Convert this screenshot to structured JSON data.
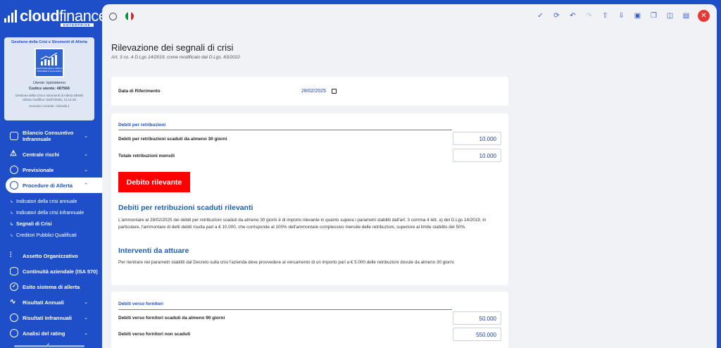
{
  "brand": {
    "name_bold": "cloud",
    "name_light": "finance",
    "tagline": "ENTERPRISE"
  },
  "card": {
    "title": "Gestione della Crisi e Strumenti di Allerta",
    "image_label": "GESTIONE DELLA CRISI E STRUMENTI DI ALLERTA",
    "user": "Utente: bpilotdemo",
    "code": "Codice utente: 487566",
    "product": "Gestione della Crisi e Strumenti di Allerta DEMO",
    "last_mod": "Ultima modifica: 04/07/2025, 12:14:40",
    "scenario": "Scenario corrente: Azienda 1"
  },
  "nav": {
    "bilancio": "Bilancio Consuntivo Infrannuale",
    "centrale": "Centrale rischi",
    "previsionale": "Previsionale",
    "procedure": "Procedure di Allerta",
    "sub": {
      "annuale": "Indicatori della crisi annuale",
      "infrannuale": "Indicatori della crisi infrannuale",
      "segnali": "Segnali di Crisi",
      "creditori": "Creditori Pubblici Qualificati"
    },
    "assetto": "Assetto Organizzativo",
    "continuita": "Continuità aziendale (ISA 570)",
    "esito": "Esito sistema di allerta",
    "annuali": "Risultati Annuali",
    "infrannuali": "Risultati Infrannuali",
    "rating": "Analisi del rating"
  },
  "page": {
    "title": "Rilevazione dei segnali di crisi",
    "subtitle": "Art. 3 co. 4 D.Lgs 14/2019, come modificato dal D.Lgs. 83/2022"
  },
  "date": {
    "label": "Data di Riferimento",
    "value": "28/02/2025"
  },
  "retribuzioni": {
    "section": "Debiti per retribuzioni",
    "row1_label": "Debiti per retribuzioni scaduti da almeno 30 giorni",
    "row1_value": "10.000",
    "row2_label": "Totale retribuzioni mensili",
    "row2_value": "10.000",
    "badge": "Debito rilevante",
    "heading1": "Debiti per retribuzioni scaduti rilevanti",
    "para1": "L'ammontare al 28/02/2025 dei debiti per retribuzioni scaduti da almeno 30 giorni è di importo rilevante in quanto supera i parametri stabiliti dall'art. 3 comma 4 lett. a) del D.Lgs 14/2019. In particolare, l'ammontare di detti debiti risulta pari a € 10.000, che corrisponde al 100% dell'ammontare complessivo mensile delle retribuzioni, superiore al limite stabilito del 50%.",
    "heading2": "Interventi da attuare",
    "para2": "Per rientrare nei parametri stabiliti dal Decreto sulla crisi l'azienda deve provvedere al versamento di un importo pari a € 5.000 delle retribuzioni dovute da almeno 30 giorni."
  },
  "fornitori": {
    "section": "Debiti verso fornitori",
    "row1_label": "Debiti verso fornitori scaduti da almeno 90 giorni",
    "row1_value": "50.000",
    "row2_label": "Debiti verso fornitori non scaduti",
    "row2_value": "550.000"
  },
  "colors": {
    "sidebar": "#1e4fc9",
    "accent_red": "#ff0000",
    "link_blue": "#1f5fb0"
  }
}
